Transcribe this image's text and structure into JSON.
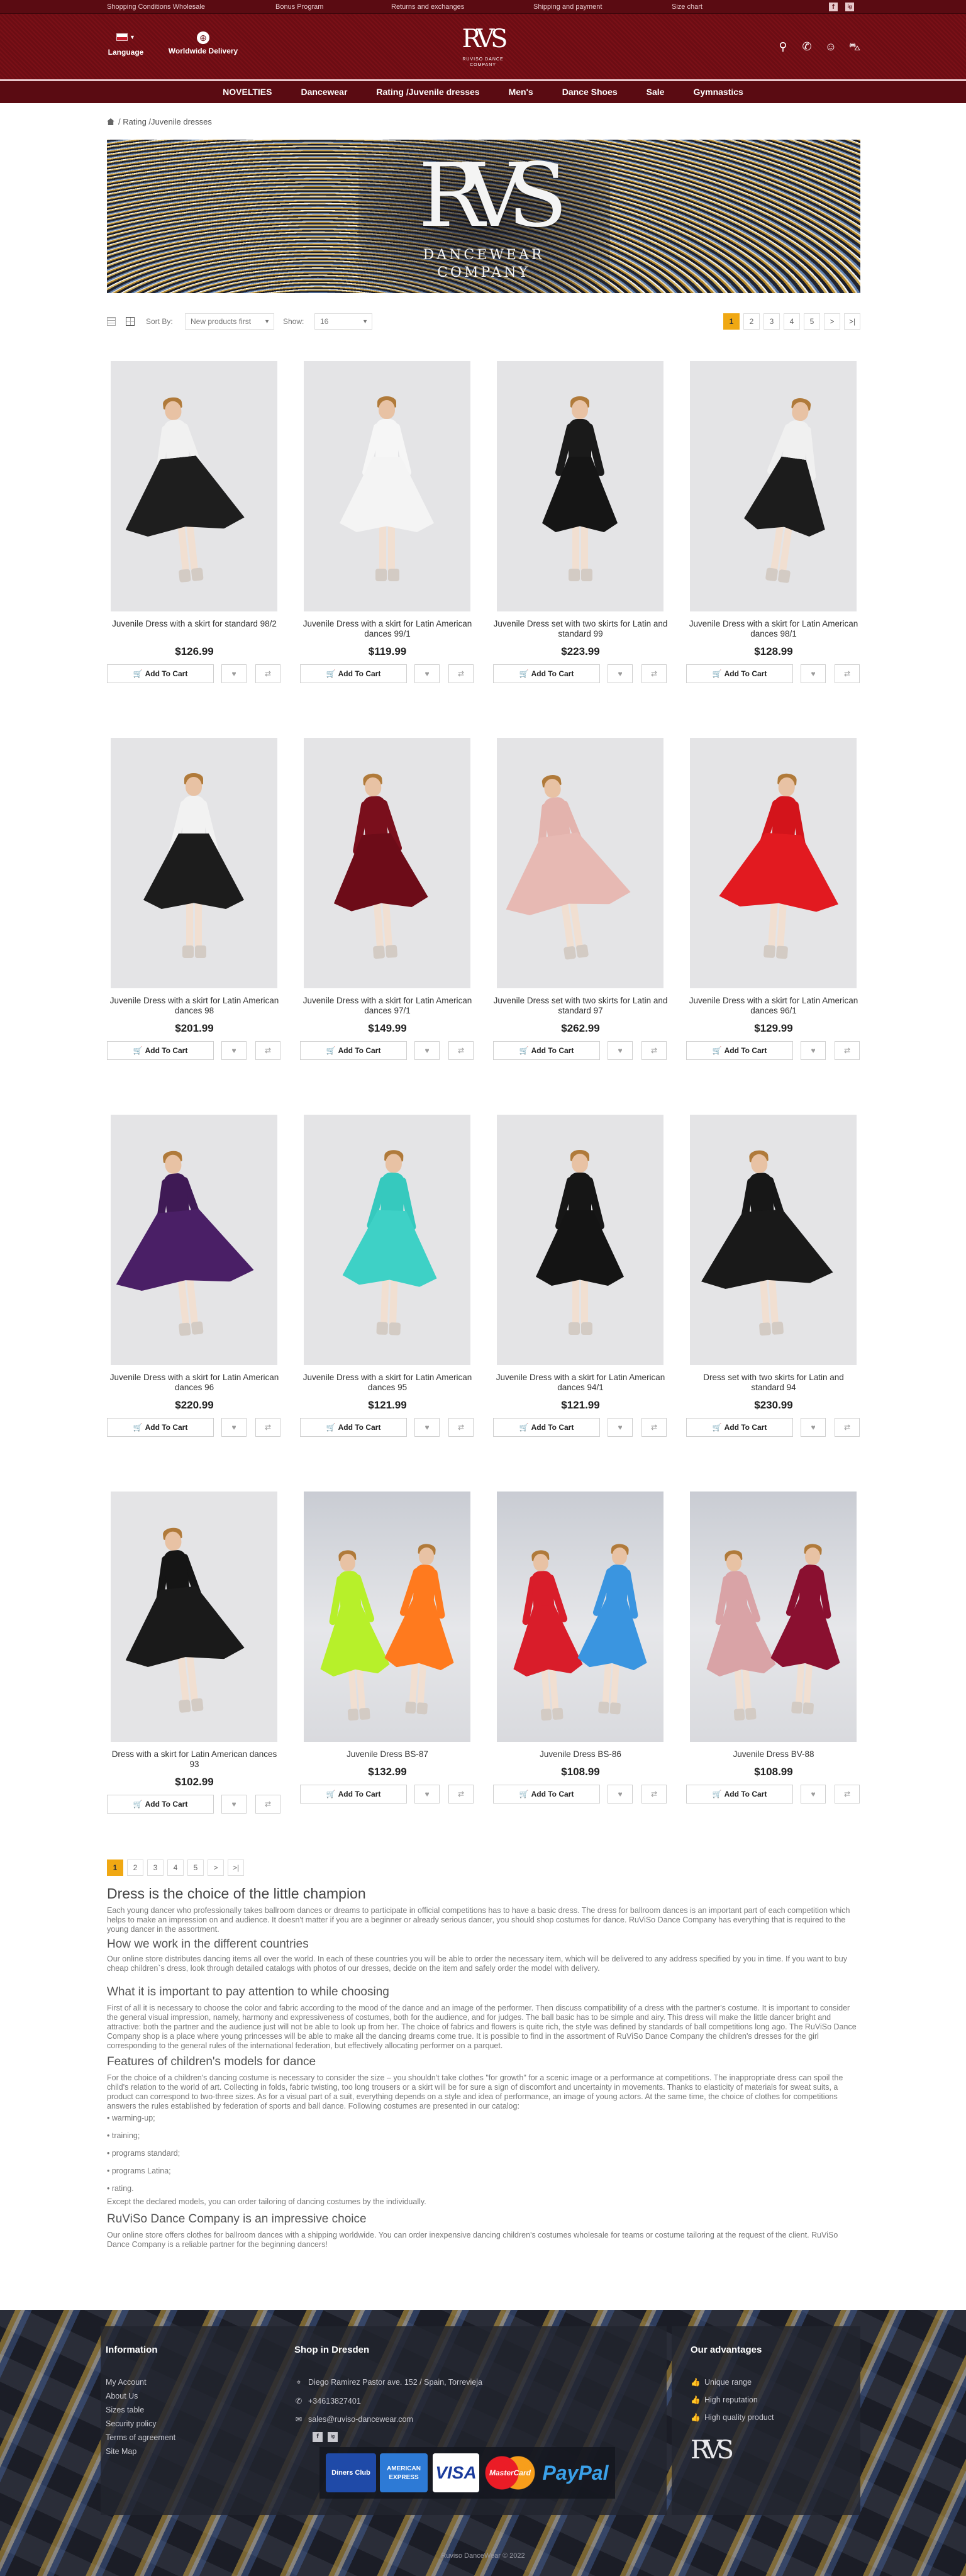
{
  "topbar": {
    "links": [
      "Shopping Conditions Wholesale",
      "Bonus Program",
      "Returns and exchanges",
      "Shipping and payment",
      "Size chart"
    ],
    "social": [
      "f",
      "ig"
    ]
  },
  "header": {
    "language_label": "Language",
    "delivery_label": "Worldwide Delivery",
    "logo_text": "RVS",
    "logo_sub": "RUVISO DANCE COMPANY"
  },
  "nav": [
    "NOVELTIES",
    "Dancewear",
    "Rating /Juvenile dresses",
    "Men's",
    "Dance Shoes",
    "Sale",
    "Gymnastics"
  ],
  "breadcrumb": {
    "current": "Rating /Juvenile dresses"
  },
  "banner": {
    "logo_text": "RVS",
    "line1": "DANCEWEAR",
    "line2": "COMPANY"
  },
  "toolbar": {
    "sort_label": "Sort By:",
    "sort_value": "New products first",
    "show_label": "Show:",
    "show_value": "16"
  },
  "pagination": [
    "1",
    "2",
    "3",
    "4",
    "5",
    ">",
    ">|"
  ],
  "pagination_bottom": [
    "1",
    "2",
    "3",
    "4",
    "5",
    ">",
    ">|"
  ],
  "add_to_cart_label": "Add To Cart",
  "products": [
    {
      "name": "Juvenile Dress with a skirt for standard 98/2",
      "price": "$126.99"
    },
    {
      "name": "Juvenile Dress with a skirt for Latin American dances 99/1",
      "price": "$119.99"
    },
    {
      "name": "Juvenile Dress set with two skirts for Latin and standard 99",
      "price": "$223.99"
    },
    {
      "name": "Juvenile Dress with a skirt for Latin American dances 98/1",
      "price": "$128.99"
    },
    {
      "name": "Juvenile Dress with a skirt for Latin American dances 98",
      "price": "$201.99"
    },
    {
      "name": "Juvenile Dress with a skirt for Latin American dances 97/1",
      "price": "$149.99"
    },
    {
      "name": "Juvenile Dress set with two skirts for Latin and standard 97",
      "price": "$262.99"
    },
    {
      "name": "Juvenile Dress with a skirt for Latin American dances 96/1",
      "price": "$129.99"
    },
    {
      "name": "Juvenile Dress with a skirt for Latin American dances 96",
      "price": "$220.99"
    },
    {
      "name": "Juvenile Dress with a skirt for Latin American dances 95",
      "price": "$121.99"
    },
    {
      "name": "Juvenile Dress with a skirt for Latin American dances 94/1",
      "price": "$121.99"
    },
    {
      "name": "Dress set with two skirts for Latin and standard 94",
      "price": "$230.99"
    },
    {
      "name": "Dress with a skirt for Latin American dances 93",
      "price": "$102.99"
    },
    {
      "name": "Juvenile Dress BS-87",
      "price": "$132.99"
    },
    {
      "name": "Juvenile Dress BS-86",
      "price": "$108.99"
    },
    {
      "name": "Juvenile Dress BV-88",
      "price": "$108.99"
    }
  ],
  "product_colors": [
    [
      "#f1f1f1",
      "#1e1e1e"
    ],
    [
      "#f6f6f6",
      "#f4f4f4"
    ],
    [
      "#1a1a1a",
      "#151515"
    ],
    [
      "#f0f0f0",
      "#1c1c1c"
    ],
    [
      "#f2f2f2",
      "#1c1c1c"
    ],
    [
      "#7a0f1c",
      "#6d0c18"
    ],
    [
      "#e3b3ad",
      "#e7b9b3"
    ],
    [
      "#d3141b",
      "#e21a20"
    ],
    [
      "#3f1a55",
      "#4a1f66"
    ],
    [
      "#36c9be",
      "#3ed1c6"
    ],
    [
      "#161616",
      "#141414"
    ],
    [
      "#171717",
      "#191919"
    ],
    [
      "#151515",
      "#1a1a1a"
    ],
    [
      "#b7f02a",
      "#ff7a1e"
    ],
    [
      "#d91d2a",
      "#3a95e0"
    ],
    [
      "#d9a3a6",
      "#8a1030"
    ]
  ],
  "seo": {
    "h1": "Dress is the choice of the little champion",
    "p1": "Each young dancer who professionally takes ballroom dances or dreams to participate in official competitions has to have a basic dress. The dress for ballroom dances is an important part of each competition which helps to make an impression on and audience. It doesn't matter if you are a beginner or already serious dancer, you should shop costumes for dance. RuViSo Dance Company has everything that is required to the young dancer in the assortment.",
    "h2a": "How we work in the different countries",
    "p2": "Our online store distributes dancing items all over the world. In each of these countries you will be able to order the necessary item, which will be delivered to any address specified by you in time. If you want to buy cheap children`s dress, look through detailed catalogs with photos of our dresses, decide on the item and safely order the model with delivery.",
    "h2b": "What it is important to pay attention to while choosing",
    "p3": "First of all it is necessary to choose the color and fabric according to the mood of the dance and an image of the performer. Then discuss compatibility of a dress with the partner's costume. It is important to consider the general visual impression, namely, harmony and expressiveness of costumes, both for the audience, and for judges. The ball basic has to be simple and airy. This dress will make the little dancer bright and attractive: both the partner and the audience just will not be able to look up from her. The choice of fabrics and flowers is quite rich, the style was defined by standards of ball competitions long ago. The RuViSo Dance Company shop is a place where young princesses will be able to make all the dancing dreams come true. It is possible to find in the assortment of RuViSo Dance Company the children's dresses for the girl corresponding to the general rules of the international federation, but effectively allocating performer on a parquet.",
    "h2c": "Features of children's models for dance",
    "p4": "For the choice of a children's dancing costume is necessary to consider the size – you shouldn't take clothes \"for growth\" for a scenic image or a performance at competitions. The inappropriate dress can spoil the child's relation to the world of art. Collecting in folds, fabric twisting, too long trousers or a skirt will be for sure a sign of discomfort and uncertainty in movements. Thanks to elasticity of materials for sweat suits, a product can correspond to two-three sizes. As for a visual part of a suit, everything depends on a style and idea of performance, an image of young actors. At the same time, the choice of clothes for competitions answers the rules established by federation of sports and ball dance. Following costumes are presented in our catalog:",
    "list": [
      "• warming-up;",
      "• training;",
      "• programs standard;",
      "• programs Latina;",
      "• rating."
    ],
    "p5": "Except the declared models, you can order tailoring of dancing costumes by the individually.",
    "h2d": "RuViSo Dance Company is an impressive choice",
    "p6": "Our online store offers clothes for ballroom dances with a shipping worldwide. You can order inexpensive dancing children's costumes wholesale for teams or costume tailoring at the request of the client. RuViSo Dance Company is a reliable partner for the beginning dancers!"
  },
  "footer": {
    "info_title": "Information",
    "info_links": [
      "My Account",
      "About Us",
      "Sizes table",
      "Security policy",
      "Terms of agreement",
      "Site Map"
    ],
    "shop_title": "Shop in Dresden",
    "address": "Diego Ramirez Pastor ave. 152 / Spain, Torrevieja",
    "phone": "+34613827401",
    "email": "sales@ruviso-dancewear.com",
    "adv_title": "Our advantages",
    "advantages": [
      "Unique range",
      "High reputation",
      "High quality product"
    ],
    "logo_text": "RVS",
    "payments": [
      "Diners Club",
      "AMERICAN EXPRESS",
      "VISA",
      "MasterCard",
      "PayPal"
    ],
    "copyright": "Ruviso DanceWear © 2022"
  },
  "colors": {
    "brand": "#6c0d14",
    "accent": "#f0a813"
  }
}
